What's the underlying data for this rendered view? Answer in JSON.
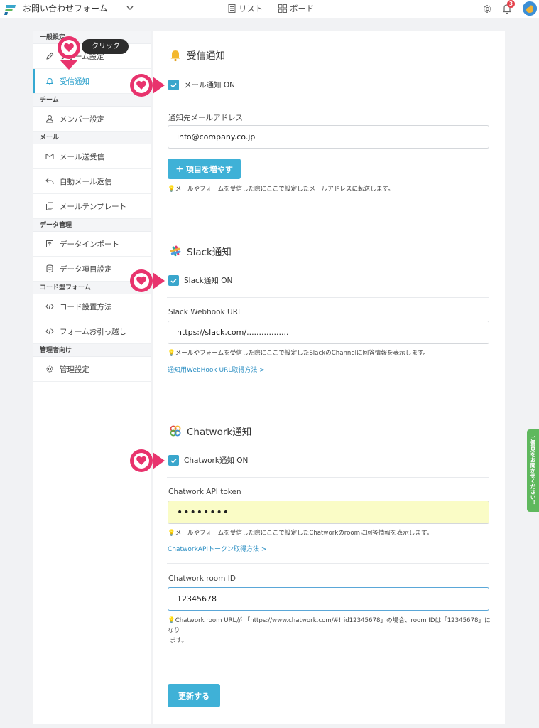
{
  "header": {
    "app_title": "お問い合わせフォーム",
    "nav": {
      "list": "リスト",
      "board": "ボード"
    },
    "notification_count": "3",
    "icons": [
      "logo-icon",
      "chevron-down-icon",
      "list-icon",
      "board-icon",
      "gear-icon",
      "bell-icon",
      "avatar"
    ]
  },
  "sidebar": {
    "sections": [
      {
        "title": "一般設定",
        "items": [
          {
            "label": "フォーム設定",
            "icon": "pencil-icon"
          },
          {
            "label": "受信通知",
            "icon": "bell-icon",
            "active": true
          }
        ]
      },
      {
        "title": "チーム",
        "items": [
          {
            "label": "メンバー設定",
            "icon": "user-icon"
          }
        ]
      },
      {
        "title": "メール",
        "items": [
          {
            "label": "メール送受信",
            "icon": "mail-icon"
          },
          {
            "label": "自動メール返信",
            "icon": "reply-icon"
          },
          {
            "label": "メールテンプレート",
            "icon": "copy-icon"
          }
        ]
      },
      {
        "title": "データ管理",
        "items": [
          {
            "label": "データインポート",
            "icon": "import-icon"
          },
          {
            "label": "データ項目設定",
            "icon": "database-icon"
          }
        ]
      },
      {
        "title": "コード型フォーム",
        "items": [
          {
            "label": "コード設置方法",
            "icon": "code-icon"
          },
          {
            "label": "フォームお引っ越し",
            "icon": "code-icon"
          }
        ]
      },
      {
        "title": "管理者向け",
        "items": [
          {
            "label": "管理設定",
            "icon": "gear-icon"
          }
        ]
      }
    ]
  },
  "tooltip": "クリック",
  "mail": {
    "title": "受信通知",
    "toggle_label": "メール通知 ON",
    "field_label": "通知先メールアドレス",
    "value": "info@company.co.jp",
    "add_button": "項目を増やす",
    "hint": "メールやフォームを受信した際にここで設定したメールアドレスに転送します。"
  },
  "slack": {
    "title": "Slack通知",
    "toggle_label": "Slack通知 ON",
    "field_label": "Slack Webhook URL",
    "value": "https://slack.com/.................",
    "hint": "メールやフォームを受信した際にここで設定したSlackのChannelに回答情報を表示します。",
    "link": "通知用WebHook URL取得方法 >"
  },
  "chatwork": {
    "title": "Chatwork通知",
    "toggle_label": "Chatwork通知 ON",
    "token_label": "Chatwork API token",
    "token_value": "••••••••",
    "token_hint": "メールやフォームを受信した際にここで設定したChatworkのroomに回答情報を表示します。",
    "token_link": "ChatworkAPIトークン取得方法 >",
    "room_label": "Chatwork room ID",
    "room_value": "12345678",
    "room_hint_1": "Chatwork room URLが 「https://www.chatwork.com/#!rid12345678」の場合、room IDは「12345678」になり",
    "room_hint_2": "ます。"
  },
  "update_button": "更新する",
  "feedback_tab": "ご意見をお聞かせください！",
  "colors": {
    "accent": "#3fb1d7",
    "pin": "#e8336d",
    "badge": "#e5404a",
    "feedback": "#5fb85d",
    "token_bg": "#fafcc6"
  }
}
